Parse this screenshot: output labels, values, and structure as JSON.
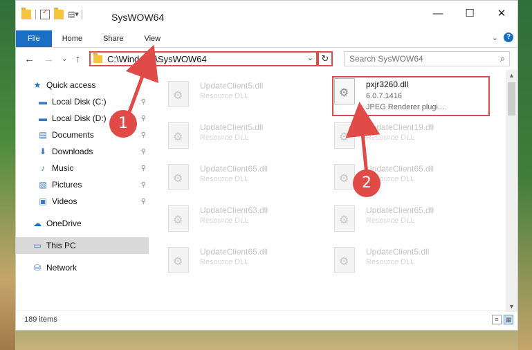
{
  "window": {
    "title": "SysWOW64",
    "controls": {
      "minimize": "—",
      "maximize": "☐",
      "close": "✕"
    }
  },
  "ribbon": {
    "tabs": [
      "File",
      "Home",
      "Share",
      "View"
    ],
    "expand_icon": "chevron-down-icon",
    "help": "?"
  },
  "address": {
    "path": "C:\\Windows\\SysWOW64",
    "dropdown": "⌄",
    "refresh": "↻"
  },
  "search": {
    "placeholder": "Search SysWOW64",
    "icon": "⌕"
  },
  "sidebar": {
    "items": [
      {
        "label": "Quick access",
        "icon": "★",
        "pinned": false
      },
      {
        "label": "Local Disk (C:)",
        "icon": "▬",
        "pinned": true
      },
      {
        "label": "Local Disk (D:)",
        "icon": "▬",
        "pinned": true
      },
      {
        "label": "Documents",
        "icon": "▤",
        "pinned": true
      },
      {
        "label": "Downloads",
        "icon": "⬇",
        "pinned": true
      },
      {
        "label": "Music",
        "icon": "♪",
        "pinned": true
      },
      {
        "label": "Pictures",
        "icon": "▧",
        "pinned": true
      },
      {
        "label": "Videos",
        "icon": "▣",
        "pinned": true
      },
      {
        "label": "OneDrive",
        "icon": "☁",
        "pinned": false
      },
      {
        "label": "This PC",
        "icon": "▭",
        "pinned": false
      },
      {
        "label": "Network",
        "icon": "⛁",
        "pinned": false
      }
    ]
  },
  "files": {
    "left_column": [
      {
        "name": "UpdateClient5.dll",
        "desc": "Resource DLL"
      },
      {
        "name": "UpdateClient5.dll",
        "desc": "Resource DLL"
      },
      {
        "name": "UpdateClient65.dll",
        "desc": "Resource DLL"
      },
      {
        "name": "UpdateClient63.dll",
        "desc": "Resource DLL"
      },
      {
        "name": "UpdateClient65.dll",
        "desc": "Resource DLL"
      }
    ],
    "selected": {
      "name": "pxjr3260.dll",
      "version": "6.0.7.1416",
      "desc": "JPEG Renderer plugi..."
    },
    "right_column": [
      {
        "name": "UpdateClient19.dll",
        "desc": "Resource DLL"
      },
      {
        "name": "UpdateClient65.dll",
        "desc": "Resource DLL"
      },
      {
        "name": "UpdateClient65.dll",
        "desc": "Resource DLL"
      },
      {
        "name": "UpdateClient5.dll",
        "desc": "Resource DLL"
      }
    ]
  },
  "status": {
    "item_count": "189 items"
  },
  "annotations": {
    "step1": "1",
    "step2": "2",
    "color": "#e04a47"
  }
}
